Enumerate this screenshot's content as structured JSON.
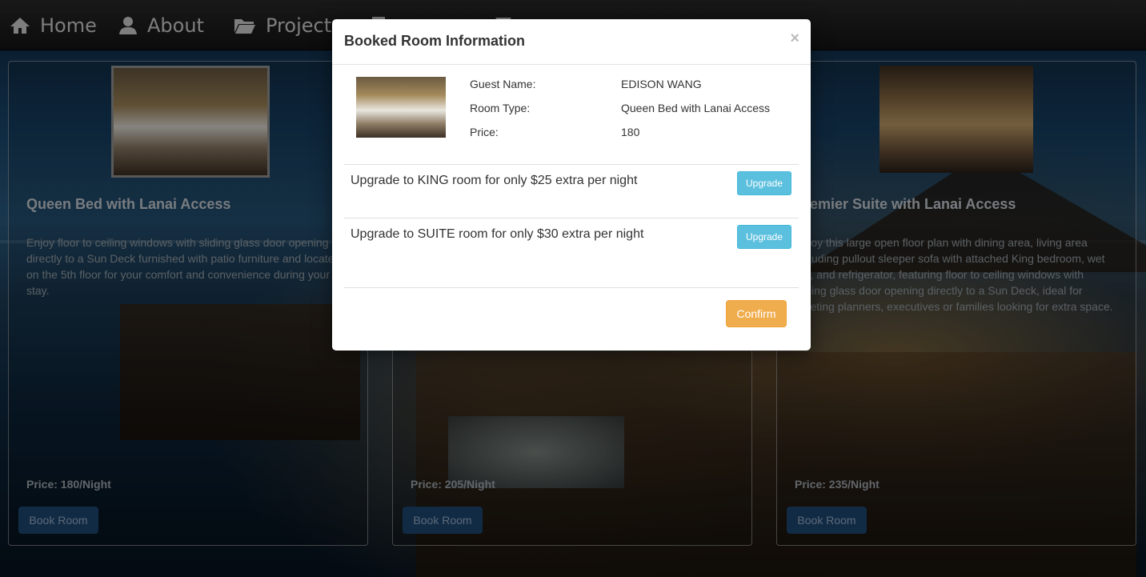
{
  "nav": {
    "items": [
      {
        "label": "Home",
        "icon": "home-icon"
      },
      {
        "label": "About",
        "icon": "user-icon"
      },
      {
        "label": "Projects",
        "icon": "folder-icon"
      }
    ]
  },
  "cards": [
    {
      "title": "Queen Bed with Lanai Access",
      "description": "Enjoy floor to ceiling windows with sliding glass door opening directly to a Sun Deck furnished with patio furniture and located on the 5th floor for your comfort and convenience during your stay.",
      "price": "Price: 180/Night",
      "button": "Book Room"
    },
    {
      "title": "",
      "description": "",
      "price": "Price: 205/Night",
      "button": "Book Room"
    },
    {
      "title": "Premier Suite with Lanai Access",
      "description": "Enjoy this large open floor plan with dining area, living area including pullout sleeper sofa with attached King bedroom, wet bar, and refrigerator, featuring floor to ceiling windows with sliding glass door opening directly to a Sun Deck, ideal for meeting planners, executives or families looking for extra space.",
      "price": "Price: 235/Night",
      "button": "Book Room"
    }
  ],
  "modal": {
    "title": "Booked Room Information",
    "close": "×",
    "guest_label": "Guest Name:",
    "guest_value": "EDISON WANG",
    "room_type_label": "Room Type:",
    "room_type_value": "Queen Bed with Lanai Access",
    "price_label": "Price:",
    "price_value": "180",
    "upgrade_king_text": "Upgrade to KING room for only $25 extra per night",
    "upgrade_suite_text": "Upgrade to SUITE room for only $30 extra per night",
    "upgrade_button": "Upgrade",
    "confirm_button": "Confirm"
  },
  "colors": {
    "upgrade": "#5bc0de",
    "confirm": "#f0ad4e",
    "book": "#1f4a78"
  }
}
